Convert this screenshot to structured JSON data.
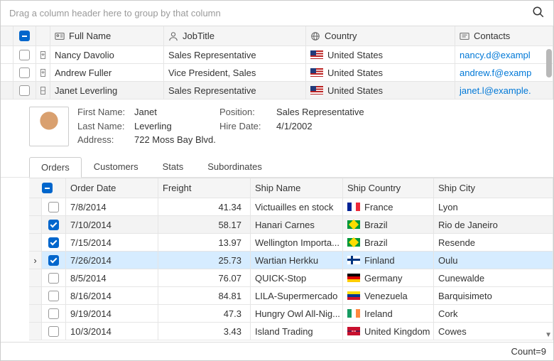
{
  "groupPanel": "Drag a column header here to group by that column",
  "cols": {
    "name": "Full Name",
    "job": "JobTitle",
    "country": "Country",
    "contacts": "Contacts"
  },
  "rows": [
    {
      "name": "Nancy Davolio",
      "job": "Sales Representative",
      "country": "United States",
      "flag": "us",
      "contact": "nancy.d@exampl",
      "exp": "+",
      "sel": false
    },
    {
      "name": "Andrew Fuller",
      "job": "Vice President, Sales",
      "country": "United States",
      "flag": "us",
      "contact": "andrew.f@examp",
      "exp": "+",
      "sel": false
    },
    {
      "name": "Janet Leverling",
      "job": "Sales Representative",
      "country": "United States",
      "flag": "us",
      "contact": "janet.l@example.",
      "exp": "–",
      "sel": true
    }
  ],
  "detail": {
    "firstNameL": "First Name:",
    "firstName": "Janet",
    "lastNameL": "Last Name:",
    "lastName": "Leverling",
    "addressL": "Address:",
    "address": "722 Moss Bay Blvd.",
    "positionL": "Position:",
    "position": "Sales Representative",
    "hireL": "Hire Date:",
    "hire": "4/1/2002"
  },
  "tabs": [
    "Orders",
    "Customers",
    "Stats",
    "Subordinates"
  ],
  "ncols": {
    "date": "Order Date",
    "freight": "Freight",
    "ship": "Ship Name",
    "country": "Ship Country",
    "city": "Ship City"
  },
  "orders": [
    {
      "chk": false,
      "date": "7/8/2014",
      "fr": "41.34",
      "ship": "Victuailles en stock",
      "ctry": "France",
      "flag": "fr",
      "city": "Lyon",
      "alt": false,
      "hl": false
    },
    {
      "chk": true,
      "date": "7/10/2014",
      "fr": "58.17",
      "ship": "Hanari Carnes",
      "ctry": "Brazil",
      "flag": "br",
      "city": "Rio de Janeiro",
      "alt": true,
      "hl": false
    },
    {
      "chk": true,
      "date": "7/15/2014",
      "fr": "13.97",
      "ship": "Wellington Importa...",
      "ctry": "Brazil",
      "flag": "br",
      "city": "Resende",
      "alt": false,
      "hl": false
    },
    {
      "chk": true,
      "date": "7/26/2014",
      "fr": "25.73",
      "ship": "Wartian Herkku",
      "ctry": "Finland",
      "flag": "fi",
      "city": "Oulu",
      "alt": false,
      "hl": true
    },
    {
      "chk": false,
      "date": "8/5/2014",
      "fr": "76.07",
      "ship": "QUICK-Stop",
      "ctry": "Germany",
      "flag": "de",
      "city": "Cunewalde",
      "alt": false,
      "hl": false
    },
    {
      "chk": false,
      "date": "8/16/2014",
      "fr": "84.81",
      "ship": "LILA-Supermercado",
      "ctry": "Venezuela",
      "flag": "ve",
      "city": "Barquisimeto",
      "alt": false,
      "hl": false
    },
    {
      "chk": false,
      "date": "9/19/2014",
      "fr": "47.3",
      "ship": "Hungry Owl All-Nig...",
      "ctry": "Ireland",
      "flag": "ie",
      "city": "Cork",
      "alt": false,
      "hl": false
    },
    {
      "chk": false,
      "date": "10/3/2014",
      "fr": "3.43",
      "ship": "Island Trading",
      "ctry": "United Kingdom",
      "flag": "uk",
      "city": "Cowes",
      "alt": false,
      "hl": false
    }
  ],
  "footer": "Count=9"
}
